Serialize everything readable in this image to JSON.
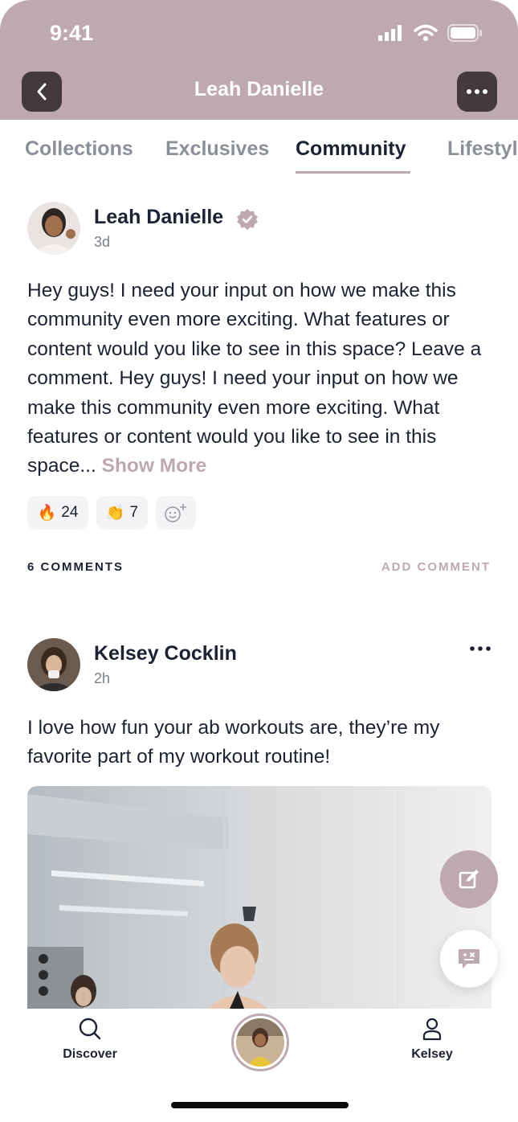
{
  "status_bar": {
    "time": "9:41"
  },
  "header": {
    "title": "Leah Danielle"
  },
  "tabs": [
    {
      "label": "Collections",
      "active": false
    },
    {
      "label": "Exclusives",
      "active": false
    },
    {
      "label": "Community",
      "active": true
    },
    {
      "label": "Lifestyl",
      "active": false
    }
  ],
  "post": {
    "author": "Leah Danielle",
    "verified": true,
    "time": "3d",
    "text": "Hey guys! I need your input on how we make this community even more exciting. What features or content would you like to see in this space? Leave a comment. Hey guys! I need your input on how we make this community even more exciting. What features or content would you like to see in this space... ",
    "show_more_label": "Show More",
    "reactions": [
      {
        "emoji": "🔥",
        "count": "24"
      },
      {
        "emoji": "👏",
        "count": "7"
      }
    ],
    "comments_count_label": "6 COMMENTS",
    "add_comment_label": "ADD COMMENT"
  },
  "comment": {
    "author": "Kelsey Cocklin",
    "time": "2h",
    "text": "I love how fun your ab workouts are, they’re my favorite part of my workout routine!"
  },
  "bottom_nav": [
    {
      "label": "Discover",
      "icon": "search-icon"
    },
    {
      "label": "",
      "icon": "creator-avatar"
    },
    {
      "label": "Kelsey",
      "icon": "person-icon"
    }
  ],
  "colors": {
    "accent": "#bea9b0",
    "dark": "#44393d",
    "text": "#1c2233"
  }
}
